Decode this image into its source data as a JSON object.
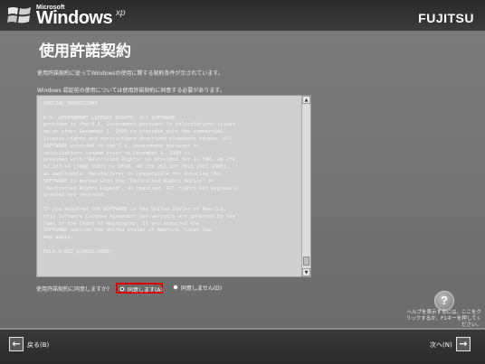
{
  "header": {
    "ms_label": "Microsoft",
    "os_label": "Windows",
    "xp_label": "xp",
    "brand": "FUJITSU"
  },
  "page": {
    "title": "使用許諾契約",
    "intro_line1": "使用許諾契約に従ってWindowsの使用に関する契約条件が示されています。",
    "intro_line2": "Windows 認証前の使用については使用許諾契約に同意する必要があります。"
  },
  "license": {
    "text": "SPECIAL PROVISIONS\n\nU.S. GOVERNMENT LICENSE RIGHTS. All SOFTWARE\nprovided to the U.S. Government pursuant to solicitations issued\non or after December 1, 1995 is provided with the commercial\nlicense rights and restrictions described elsewhere herein. All\nSOFTWARE provided to the U.S. Government pursuant to\nsolicitations issued prior to December 1, 1995 is\nprovided with \"Restricted Rights\" as provided for in FAR, 48 CFR\n52.227-14 (JUNE 1987) or DFAR, 48 CFR 252.227-7013 (OCT 1988),\nas applicable. Manufacturer is responsible for ensuring the\nSOFTWARE is marked with the \"Restricted Rights Notice\" or\n\"Restricted Rights Legend\", as required. All rights not expressly\ngranted are reserved.\n\nIf you acquired the SOFTWARE in the United States of America,\nthis Software License Agreement and warranty are governed by the\nlaws of the State of Washington. If you acquired the\nSOFTWARE outside the United States of America, local law\nmay apply.\n\nEULA.D-WZ2_A(0615-2005)"
  },
  "consent": {
    "prompt": "使用許諾契約に同意しますか?",
    "accept_label": "同意します(A)",
    "decline_label": "同意しません(D)",
    "selected": "accept"
  },
  "help": {
    "glyph": "?",
    "text": "ヘルプを表示するには、ここをクリックするか、F1キーを押してください。"
  },
  "nav": {
    "back_label": "戻る(B)",
    "next_label": "次へ(N)"
  },
  "icons": {
    "windows_logo": "windows-logo-icon",
    "help": "help-icon",
    "back": "back-arrow-icon",
    "next": "next-arrow-icon"
  },
  "colors": {
    "highlight": "#e00000",
    "background": "#6c6c6c"
  }
}
